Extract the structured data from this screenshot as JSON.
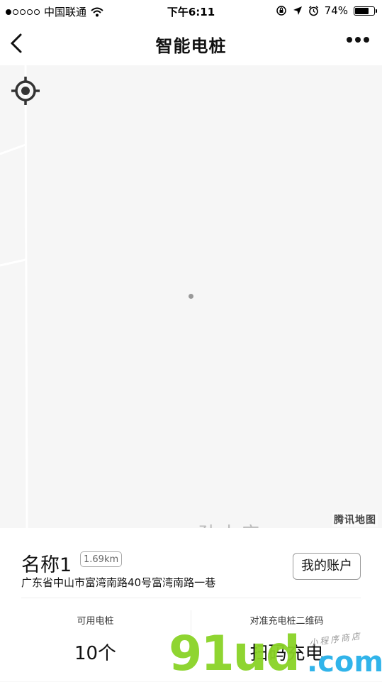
{
  "status_bar": {
    "carrier": "中国联通",
    "time": "下午6:11",
    "battery_text": "74%",
    "battery_level": 0.74,
    "signal_bars_filled": 1,
    "signal_bars_total": 5
  },
  "nav": {
    "title": "智能电桩"
  },
  "map": {
    "place_label": "孙小店",
    "provider_logo": "腾讯地图"
  },
  "station": {
    "name": "名称1",
    "distance": "1.69km",
    "address": "广东省中山市富湾南路40号富湾南路一巷",
    "account_button": "我的账户",
    "available_label": "可用电桩",
    "available_value": "10个",
    "scan_label": "对准充电桩二维码",
    "scan_action": "扫码充电"
  },
  "watermark": {
    "brand": "91ud",
    "tld": ".com",
    "shop": "小程序商店"
  },
  "colors": {
    "watermark_green": "#8ad326",
    "watermark_blue": "#31b4ea"
  }
}
